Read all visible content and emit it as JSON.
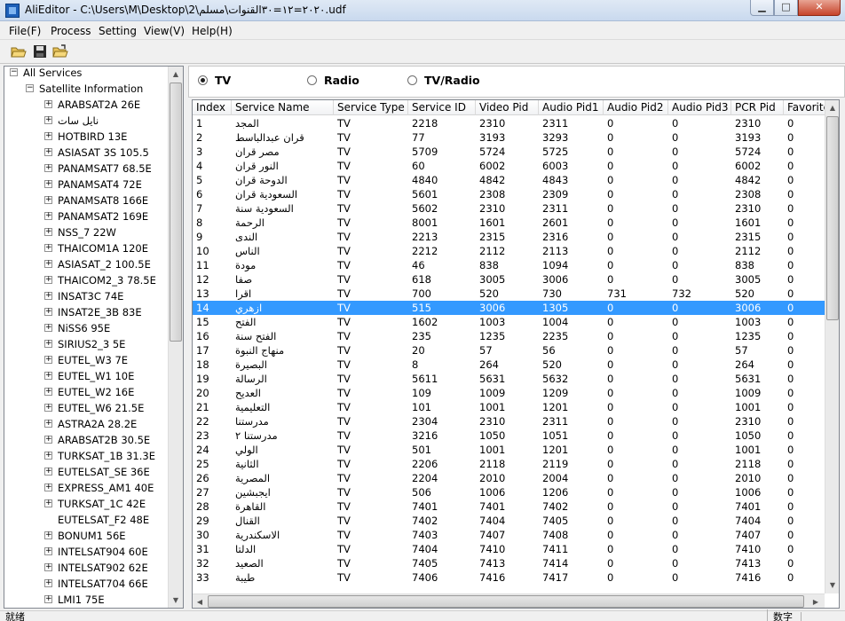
{
  "window": {
    "title": "AliEditor - C:\\Users\\M\\Desktop\\2\\٢٠٢٠=١٢=٣٠القنوات\\مسلم.udf",
    "min_glyph": "▁",
    "max_glyph": "□",
    "close_glyph": "✕"
  },
  "menu": [
    "File(F)",
    "Process",
    "Setting",
    "View(V)",
    "Help(H)"
  ],
  "toolbar": [
    {
      "icon": "open-folder-icon"
    },
    {
      "icon": "save-disk-icon"
    },
    {
      "icon": "open-file-icon"
    }
  ],
  "tree": {
    "root": "All Services",
    "group": "Satellite Information",
    "satellites": [
      {
        "label": "ARABSAT2A 26E",
        "expandable": true
      },
      {
        "label": "نايل سات",
        "expandable": true
      },
      {
        "label": "HOTBIRD 13E",
        "expandable": true
      },
      {
        "label": "ASIASAT 3S 105.5",
        "expandable": true
      },
      {
        "label": "PANAMSAT7 68.5E",
        "expandable": true
      },
      {
        "label": "PANAMSAT4 72E",
        "expandable": true
      },
      {
        "label": "PANAMSAT8 166E",
        "expandable": true
      },
      {
        "label": "PANAMSAT2 169E",
        "expandable": true
      },
      {
        "label": "NSS_7 22W",
        "expandable": true
      },
      {
        "label": "THAICOM1A 120E",
        "expandable": true
      },
      {
        "label": "ASIASAT_2 100.5E",
        "expandable": true
      },
      {
        "label": "THAICOM2_3 78.5E",
        "expandable": true
      },
      {
        "label": "INSAT3C 74E",
        "expandable": true
      },
      {
        "label": "INSAT2E_3B 83E",
        "expandable": true
      },
      {
        "label": "NiSS6 95E",
        "expandable": true
      },
      {
        "label": "SIRIUS2_3 5E",
        "expandable": true
      },
      {
        "label": "EUTEL_W3 7E",
        "expandable": true
      },
      {
        "label": "EUTEL_W1 10E",
        "expandable": true
      },
      {
        "label": "EUTEL_W2 16E",
        "expandable": true
      },
      {
        "label": "EUTEL_W6 21.5E",
        "expandable": true
      },
      {
        "label": "ASTRA2A 28.2E",
        "expandable": true
      },
      {
        "label": "ARABSAT2B 30.5E",
        "expandable": true
      },
      {
        "label": "TURKSAT_1B 31.3E",
        "expandable": true
      },
      {
        "label": "EUTELSAT_SE 36E",
        "expandable": true
      },
      {
        "label": "EXPRESS_AM1 40E",
        "expandable": true
      },
      {
        "label": "TURKSAT_1C 42E",
        "expandable": true
      },
      {
        "label": "EUTELSAT_F2 48E",
        "expandable": false
      },
      {
        "label": "BONUM1 56E",
        "expandable": true
      },
      {
        "label": "INTELSAT904 60E",
        "expandable": true
      },
      {
        "label": "INTELSAT902 62E",
        "expandable": true
      },
      {
        "label": "INTELSAT704 66E",
        "expandable": true
      },
      {
        "label": "LMI1 75E",
        "expandable": true
      }
    ]
  },
  "filter": {
    "options": [
      "TV",
      "Radio",
      "TV/Radio"
    ],
    "selected": "TV"
  },
  "grid": {
    "columns": [
      "Index",
      "Service Name",
      "Service Type",
      "Service ID",
      "Video Pid",
      "Audio Pid1",
      "Audio Pid2",
      "Audio Pid3",
      "PCR Pid",
      "Favorite"
    ],
    "selected_index": "14",
    "rows": [
      [
        "1",
        "المجد",
        "TV",
        "2218",
        "2310",
        "2311",
        "0",
        "0",
        "2310",
        "0"
      ],
      [
        "2",
        "قران عبدالباسط",
        "TV",
        "77",
        "3193",
        "3293",
        "0",
        "0",
        "3193",
        "0"
      ],
      [
        "3",
        "مصر قران",
        "TV",
        "5709",
        "5724",
        "5725",
        "0",
        "0",
        "5724",
        "0"
      ],
      [
        "4",
        "النور قران",
        "TV",
        "60",
        "6002",
        "6003",
        "0",
        "0",
        "6002",
        "0"
      ],
      [
        "5",
        "الدوحة قران",
        "TV",
        "4840",
        "4842",
        "4843",
        "0",
        "0",
        "4842",
        "0"
      ],
      [
        "6",
        "السعودية قران",
        "TV",
        "5601",
        "2308",
        "2309",
        "0",
        "0",
        "2308",
        "0"
      ],
      [
        "7",
        "السعودية سنة",
        "TV",
        "5602",
        "2310",
        "2311",
        "0",
        "0",
        "2310",
        "0"
      ],
      [
        "8",
        "الرحمة",
        "TV",
        "8001",
        "1601",
        "2601",
        "0",
        "0",
        "1601",
        "0"
      ],
      [
        "9",
        "الندى",
        "TV",
        "2213",
        "2315",
        "2316",
        "0",
        "0",
        "2315",
        "0"
      ],
      [
        "10",
        "الناس",
        "TV",
        "2212",
        "2112",
        "2113",
        "0",
        "0",
        "2112",
        "0"
      ],
      [
        "11",
        "مودة",
        "TV",
        "46",
        "838",
        "1094",
        "0",
        "0",
        "838",
        "0"
      ],
      [
        "12",
        "صفا",
        "TV",
        "618",
        "3005",
        "3006",
        "0",
        "0",
        "3005",
        "0"
      ],
      [
        "13",
        "اقرا",
        "TV",
        "700",
        "520",
        "730",
        "731",
        "732",
        "520",
        "0"
      ],
      [
        "14",
        "ازهري",
        "TV",
        "515",
        "3006",
        "1305",
        "0",
        "0",
        "3006",
        "0"
      ],
      [
        "15",
        "الفتح",
        "TV",
        "1602",
        "1003",
        "1004",
        "0",
        "0",
        "1003",
        "0"
      ],
      [
        "16",
        "الفتح سنة",
        "TV",
        "235",
        "1235",
        "2235",
        "0",
        "0",
        "1235",
        "0"
      ],
      [
        "17",
        "منهاج النبوة",
        "TV",
        "20",
        "57",
        "56",
        "0",
        "0",
        "57",
        "0"
      ],
      [
        "18",
        "البصيرة",
        "TV",
        "8",
        "264",
        "520",
        "0",
        "0",
        "264",
        "0"
      ],
      [
        "19",
        "الرسالة",
        "TV",
        "5611",
        "5631",
        "5632",
        "0",
        "0",
        "5631",
        "0"
      ],
      [
        "20",
        "العديح",
        "TV",
        "109",
        "1009",
        "1209",
        "0",
        "0",
        "1009",
        "0"
      ],
      [
        "21",
        "التعليمية",
        "TV",
        "101",
        "1001",
        "1201",
        "0",
        "0",
        "1001",
        "0"
      ],
      [
        "22",
        "مدرستنا",
        "TV",
        "2304",
        "2310",
        "2311",
        "0",
        "0",
        "2310",
        "0"
      ],
      [
        "23",
        "مدرستنا ٢",
        "TV",
        "3216",
        "1050",
        "1051",
        "0",
        "0",
        "1050",
        "0"
      ],
      [
        "24",
        "الولي",
        "TV",
        "501",
        "1001",
        "1201",
        "0",
        "0",
        "1001",
        "0"
      ],
      [
        "25",
        "الثانية",
        "TV",
        "2206",
        "2118",
        "2119",
        "0",
        "0",
        "2118",
        "0"
      ],
      [
        "26",
        "المصرية",
        "TV",
        "2204",
        "2010",
        "2004",
        "0",
        "0",
        "2010",
        "0"
      ],
      [
        "27",
        "ايجبشين",
        "TV",
        "506",
        "1006",
        "1206",
        "0",
        "0",
        "1006",
        "0"
      ],
      [
        "28",
        "القاهرة",
        "TV",
        "7401",
        "7401",
        "7402",
        "0",
        "0",
        "7401",
        "0"
      ],
      [
        "29",
        "القنال",
        "TV",
        "7402",
        "7404",
        "7405",
        "0",
        "0",
        "7404",
        "0"
      ],
      [
        "30",
        "الاسكندرية",
        "TV",
        "7403",
        "7407",
        "7408",
        "0",
        "0",
        "7407",
        "0"
      ],
      [
        "31",
        "الدلتا",
        "TV",
        "7404",
        "7410",
        "7411",
        "0",
        "0",
        "7410",
        "0"
      ],
      [
        "32",
        "الصعيد",
        "TV",
        "7405",
        "7413",
        "7414",
        "0",
        "0",
        "7413",
        "0"
      ],
      [
        "33",
        "طيبة",
        "TV",
        "7406",
        "7416",
        "7417",
        "0",
        "0",
        "7416",
        "0"
      ]
    ]
  },
  "status": {
    "left": "就绪",
    "right": "数字"
  },
  "colors": {
    "selection": "#3399ff",
    "window_bg": "#f0f0f0"
  }
}
